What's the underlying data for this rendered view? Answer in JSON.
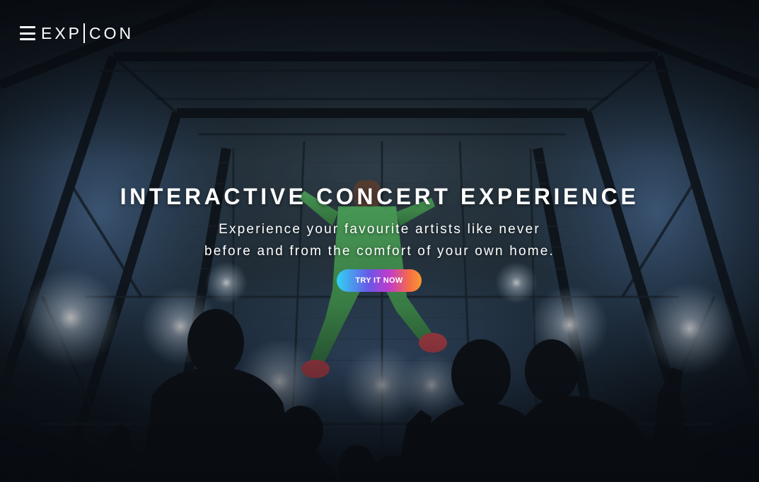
{
  "header": {
    "menu_icon": "hamburger-menu-icon",
    "logo_left": "EXP",
    "logo_right": "CON"
  },
  "hero": {
    "background_image": "concert-crowd-photo",
    "title": "INTERACTIVE CONCERT EXPERIENCE",
    "subtitle_line_1": "Experience your favourite artists like never",
    "subtitle_line_2": "before and from the comfort of your own home.",
    "cta_label": "TRY IT NOW"
  },
  "colors": {
    "text": "#ffffff",
    "cta_gradient": [
      "#2fd4f2",
      "#6a56e8",
      "#c13cc9",
      "#f56b4a",
      "#f79a2e"
    ]
  }
}
